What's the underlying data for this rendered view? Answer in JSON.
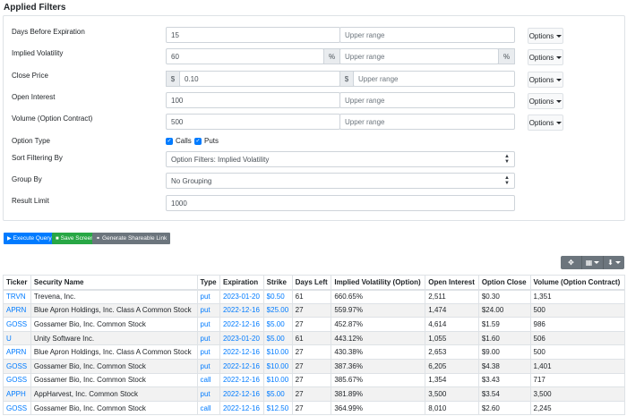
{
  "page_title": "Applied Filters",
  "filters": {
    "days_before_expiration": {
      "label": "Days Before Expiration",
      "value": "15",
      "upper_placeholder": "Upper range"
    },
    "implied_volatility": {
      "label": "Implied Volatility",
      "value": "60",
      "unit": "%",
      "upper_placeholder": "Upper range"
    },
    "close_price": {
      "label": "Close Price",
      "currency": "$",
      "value": "0.10",
      "upper_placeholder": "Upper range"
    },
    "open_interest": {
      "label": "Open Interest",
      "value": "100",
      "upper_placeholder": "Upper range"
    },
    "volume": {
      "label": "Volume (Option Contract)",
      "value": "500",
      "upper_placeholder": "Upper range"
    },
    "option_type": {
      "label": "Option Type",
      "calls_label": "Calls",
      "puts_label": "Puts",
      "calls_checked": true,
      "puts_checked": true
    },
    "sort_filtering": {
      "label": "Sort Filtering By",
      "selected": "Option Filters: Implied Volatility"
    },
    "group_by": {
      "label": "Group By",
      "selected": "No Grouping"
    },
    "result_limit": {
      "label": "Result Limit",
      "value": "1000"
    },
    "options_label": "Options"
  },
  "actions": {
    "execute_query": "Execute Query",
    "save_screen": "Save Screen",
    "generate_link": "Generate Shareable Link"
  },
  "colors": {
    "primary": "#007bff",
    "success": "#28a745",
    "secondary": "#6c757d"
  },
  "table": {
    "headers": [
      "Ticker",
      "Security Name",
      "Type",
      "Expiration",
      "Strike",
      "Days Left",
      "Implied Volatility (Option)",
      "Open Interest",
      "Option Close",
      "Volume (Option Contract)"
    ],
    "rows": [
      [
        "TRVN",
        "Trevena, Inc.",
        "put",
        "2023-01-20",
        "$0.50",
        "61",
        "660.65%",
        "2,511",
        "$0.30",
        "1,351"
      ],
      [
        "APRN",
        "Blue Apron Holdings, Inc. Class A Common Stock",
        "put",
        "2022-12-16",
        "$25.00",
        "27",
        "559.97%",
        "1,474",
        "$24.00",
        "500"
      ],
      [
        "GOSS",
        "Gossamer Bio, Inc. Common Stock",
        "put",
        "2022-12-16",
        "$5.00",
        "27",
        "452.87%",
        "4,614",
        "$1.59",
        "986"
      ],
      [
        "U",
        "Unity Software Inc.",
        "put",
        "2023-01-20",
        "$5.00",
        "61",
        "443.12%",
        "1,055",
        "$1.60",
        "506"
      ],
      [
        "APRN",
        "Blue Apron Holdings, Inc. Class A Common Stock",
        "put",
        "2022-12-16",
        "$10.00",
        "27",
        "430.38%",
        "2,653",
        "$9.00",
        "500"
      ],
      [
        "GOSS",
        "Gossamer Bio, Inc. Common Stock",
        "put",
        "2022-12-16",
        "$10.00",
        "27",
        "387.36%",
        "6,205",
        "$4.38",
        "1,401"
      ],
      [
        "GOSS",
        "Gossamer Bio, Inc. Common Stock",
        "call",
        "2022-12-16",
        "$10.00",
        "27",
        "385.67%",
        "1,354",
        "$3.43",
        "717"
      ],
      [
        "APPH",
        "AppHarvest, Inc. Common Stock",
        "put",
        "2022-12-16",
        "$5.00",
        "27",
        "381.89%",
        "3,500",
        "$3.54",
        "3,500"
      ],
      [
        "GOSS",
        "Gossamer Bio, Inc. Common Stock",
        "call",
        "2022-12-16",
        "$12.50",
        "27",
        "364.99%",
        "8,010",
        "$2.60",
        "2,245"
      ]
    ]
  }
}
